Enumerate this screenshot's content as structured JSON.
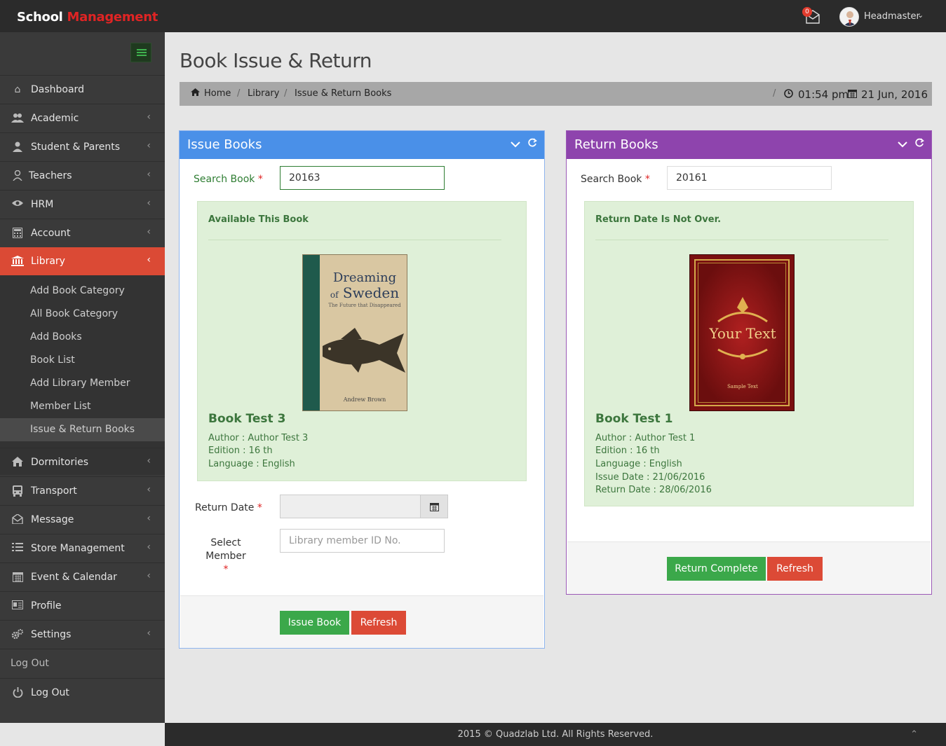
{
  "app": {
    "brand_part1": "School",
    "brand_part2": "Management"
  },
  "header": {
    "mail_count": "0",
    "user_name": "Headmaster",
    "caret": "⌄"
  },
  "sidebar": {
    "items": [
      {
        "label": "Dashboard"
      },
      {
        "label": "Academic"
      },
      {
        "label": "Student & Parents"
      },
      {
        "label": "Teachers"
      },
      {
        "label": "HRM"
      },
      {
        "label": "Account"
      },
      {
        "label": "Library"
      },
      {
        "label": "Dormitories"
      },
      {
        "label": "Transport"
      },
      {
        "label": "Message"
      },
      {
        "label": "Store Management"
      },
      {
        "label": "Event & Calendar"
      },
      {
        "label": "Profile"
      },
      {
        "label": "Settings"
      }
    ],
    "library_submenu": [
      "Add Book Category",
      "All Book Category",
      "Add Books",
      "Book List",
      "Add Library Member",
      "Member List",
      "Issue & Return Books"
    ],
    "logout_plain": "Log Out",
    "logout_item": "Log Out",
    "chevron": "‹"
  },
  "page": {
    "title": "Book Issue & Return"
  },
  "breadcrumb": {
    "home": "Home",
    "library": "Library",
    "current": "Issue & Return Books",
    "sep": "/",
    "time": "01:54 pm",
    "date": "21 Jun, 2016"
  },
  "issue_panel": {
    "title": "Issue Books",
    "header_color": "#4a90e8",
    "search_label": "Search Book",
    "search_value": "20163",
    "required_mark": "*",
    "status": "Available This Book",
    "cover_title1": "Dreaming",
    "cover_title2": "of",
    "cover_title3": "Sweden",
    "cover_subtitle": "The Future that Disappeared",
    "cover_author": "Andrew Brown",
    "book_title": "Book Test 3",
    "author": "Author : Author Test 3",
    "edition": "Edition : 16 th",
    "language": "Language : English",
    "return_date_label": "Return Date",
    "select_member_label": "Select Member",
    "member_placeholder": "Library member ID No.",
    "issue_button": "Issue Book",
    "refresh_button": "Refresh"
  },
  "return_panel": {
    "title": "Return Books",
    "header_color": "#8e44ad",
    "search_label": "Search Book",
    "search_value": "20161",
    "required_mark": "*",
    "status": "Return Date Is Not Over.",
    "cover_text": "Your Text",
    "cover_small": "Sample Text",
    "book_title": "Book Test 1",
    "author": "Author : Author Test 1",
    "edition": "Edition : 16 th",
    "language": "Language : English",
    "issue_date": "Issue Date : 21/06/2016",
    "return_date": "Return Date : 28/06/2016",
    "complete_button": "Return Complete",
    "refresh_button": "Refresh"
  },
  "footer": {
    "text": "2015 © Quadzlab Ltd. All Rights Reserved.",
    "up": "⌃"
  }
}
